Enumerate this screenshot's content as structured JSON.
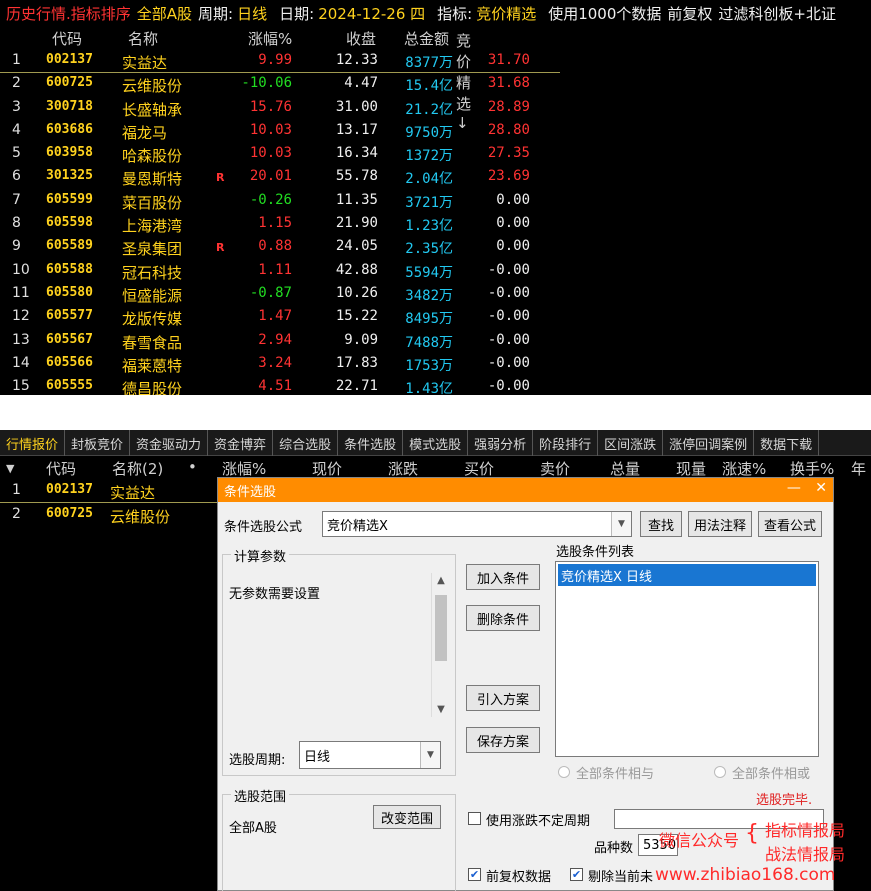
{
  "top_bar": {
    "mode": "历史行情.指标排序",
    "market": "全部A股",
    "period_label": "周期:",
    "period_value": "日线",
    "date_label": "日期:",
    "date_value": "2024-12-26 四",
    "indicator_label": "指标:",
    "indicator_value": "竞价精选",
    "data_note": "使用1000个数据",
    "adjust": "前复权",
    "filter": "过滤科创板+北证"
  },
  "top_columns": [
    "代码",
    "名称",
    "涨幅%",
    "收盘",
    "总金额",
    "竞价精选↓"
  ],
  "top_rows": [
    {
      "idx": "1",
      "code": "002137",
      "name": "实益达",
      "flag": "",
      "pct": "9.99",
      "close": "12.33",
      "amount": "8377万",
      "score": "31.70",
      "pct_color": "red",
      "score_color": "red"
    },
    {
      "idx": "2",
      "code": "600725",
      "name": "云维股份",
      "flag": "",
      "pct": "-10.06",
      "close": "4.47",
      "amount": "15.4亿",
      "score": "31.68",
      "pct_color": "green",
      "score_color": "red"
    },
    {
      "idx": "3",
      "code": "300718",
      "name": "长盛轴承",
      "flag": "",
      "pct": "15.76",
      "close": "31.00",
      "amount": "21.2亿",
      "score": "28.89",
      "pct_color": "red",
      "score_color": "red"
    },
    {
      "idx": "4",
      "code": "603686",
      "name": "福龙马",
      "flag": "",
      "pct": "10.03",
      "close": "13.17",
      "amount": "9750万",
      "score": "28.80",
      "pct_color": "red",
      "score_color": "red"
    },
    {
      "idx": "5",
      "code": "603958",
      "name": "哈森股份",
      "flag": "",
      "pct": "10.03",
      "close": "16.34",
      "amount": "1372万",
      "score": "27.35",
      "pct_color": "red",
      "score_color": "red"
    },
    {
      "idx": "6",
      "code": "301325",
      "name": "曼恩斯特",
      "flag": "R",
      "pct": "20.01",
      "close": "55.78",
      "amount": "2.04亿",
      "score": "23.69",
      "pct_color": "red",
      "score_color": "red"
    },
    {
      "idx": "7",
      "code": "605599",
      "name": "菜百股份",
      "flag": "",
      "pct": "-0.26",
      "close": "11.35",
      "amount": "3721万",
      "score": "0.00",
      "pct_color": "green",
      "score_color": "white"
    },
    {
      "idx": "8",
      "code": "605598",
      "name": "上海港湾",
      "flag": "",
      "pct": "1.15",
      "close": "21.90",
      "amount": "1.23亿",
      "score": "0.00",
      "pct_color": "red",
      "score_color": "white"
    },
    {
      "idx": "9",
      "code": "605589",
      "name": "圣泉集团",
      "flag": "R",
      "pct": "0.88",
      "close": "24.05",
      "amount": "2.35亿",
      "score": "0.00",
      "pct_color": "red",
      "score_color": "white"
    },
    {
      "idx": "10",
      "code": "605588",
      "name": "冠石科技",
      "flag": "",
      "pct": "1.11",
      "close": "42.88",
      "amount": "5594万",
      "score": "-0.00",
      "pct_color": "red",
      "score_color": "white"
    },
    {
      "idx": "11",
      "code": "605580",
      "name": "恒盛能源",
      "flag": "",
      "pct": "-0.87",
      "close": "10.26",
      "amount": "3482万",
      "score": "-0.00",
      "pct_color": "green",
      "score_color": "white"
    },
    {
      "idx": "12",
      "code": "605577",
      "name": "龙版传媒",
      "flag": "",
      "pct": "1.47",
      "close": "15.22",
      "amount": "8495万",
      "score": "-0.00",
      "pct_color": "red",
      "score_color": "white"
    },
    {
      "idx": "13",
      "code": "605567",
      "name": "春雪食品",
      "flag": "",
      "pct": "2.94",
      "close": "9.09",
      "amount": "7488万",
      "score": "-0.00",
      "pct_color": "red",
      "score_color": "white"
    },
    {
      "idx": "14",
      "code": "605566",
      "name": "福莱蒽特",
      "flag": "",
      "pct": "3.24",
      "close": "17.83",
      "amount": "1753万",
      "score": "-0.00",
      "pct_color": "red",
      "score_color": "white"
    },
    {
      "idx": "15",
      "code": "605555",
      "name": "德昌股份",
      "flag": "",
      "pct": "4.51",
      "close": "22.71",
      "amount": "1.43亿",
      "score": "-0.00",
      "pct_color": "red",
      "score_color": "white"
    }
  ],
  "bottom_tabs": [
    "行情报价",
    "封板竞价",
    "资金驱动力",
    "资金博弈",
    "综合选股",
    "条件选股",
    "模式选股",
    "强弱分析",
    "阶段排行",
    "区间涨跌",
    "涨停回调案例",
    "数据下载"
  ],
  "bottom_columns": [
    "代码",
    "名称(2)",
    "•",
    "涨幅%",
    "现价",
    "涨跌",
    "买价",
    "卖价",
    "总量",
    "现量",
    "涨速%",
    "换手%",
    "年"
  ],
  "bottom_rows": [
    {
      "idx": "1",
      "code": "002137",
      "name": "实益达"
    },
    {
      "idx": "2",
      "code": "600725",
      "name": "云维股份"
    }
  ],
  "dialog": {
    "title": "条件选股",
    "formula_label": "条件选股公式",
    "formula_value": "竞价精选X",
    "btn_find": "查找",
    "btn_usage": "用法注释",
    "btn_view": "查看公式",
    "params_title": "计算参数",
    "params_text": "无参数需要设置",
    "period_label": "选股周期:",
    "period_value": "日线",
    "btn_add": "加入条件",
    "btn_delete": "删除条件",
    "btn_import": "引入方案",
    "btn_save": "保存方案",
    "list_title": "选股条件列表",
    "list_item": "竞价精选X  日线",
    "radio_and": "全部条件相与",
    "radio_or": "全部条件相或",
    "status": "选股完毕.",
    "range_title": "选股范围",
    "range_value": "全部A股",
    "btn_change_range": "改变范围",
    "chk_uncertain": "使用涨跌不定周期",
    "count_label": "品种数",
    "count_value": "5350",
    "chk_adjust": "前复权数据",
    "chk_remove": "剔除当前未"
  },
  "watermark": {
    "wechat": "微信公众号",
    "name1": "指标情报局",
    "name2": "战法情报局",
    "site": "www.zhibiao168.com"
  }
}
